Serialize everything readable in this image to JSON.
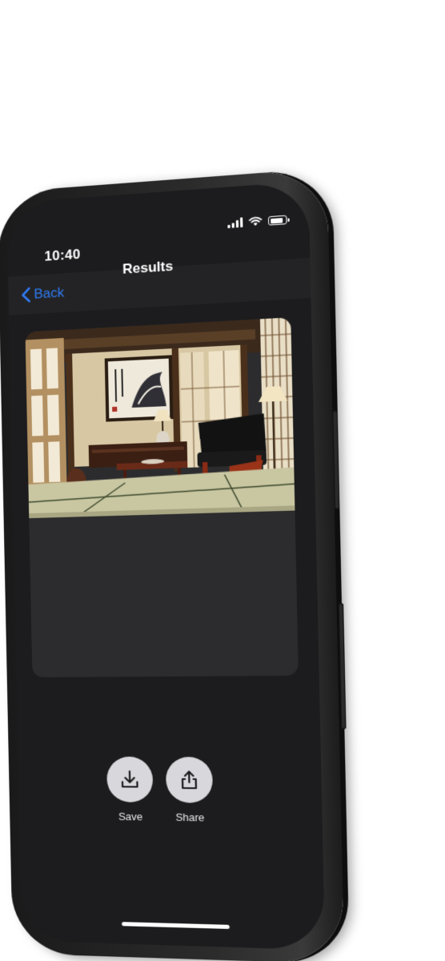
{
  "status_bar": {
    "time": "10:40",
    "icons": [
      "signal-icon",
      "wifi-icon",
      "battery-icon"
    ]
  },
  "nav": {
    "back_label": "Back",
    "title": "Results"
  },
  "result": {
    "image_semantic": "japanese-room-image"
  },
  "actions": {
    "save_label": "Save",
    "share_label": "Share"
  },
  "colors": {
    "accent": "#2f7bf5",
    "screen_bg": "#1c1c1e",
    "card_bg": "#2c2c2e",
    "action_bg": "#d8d8dc"
  }
}
